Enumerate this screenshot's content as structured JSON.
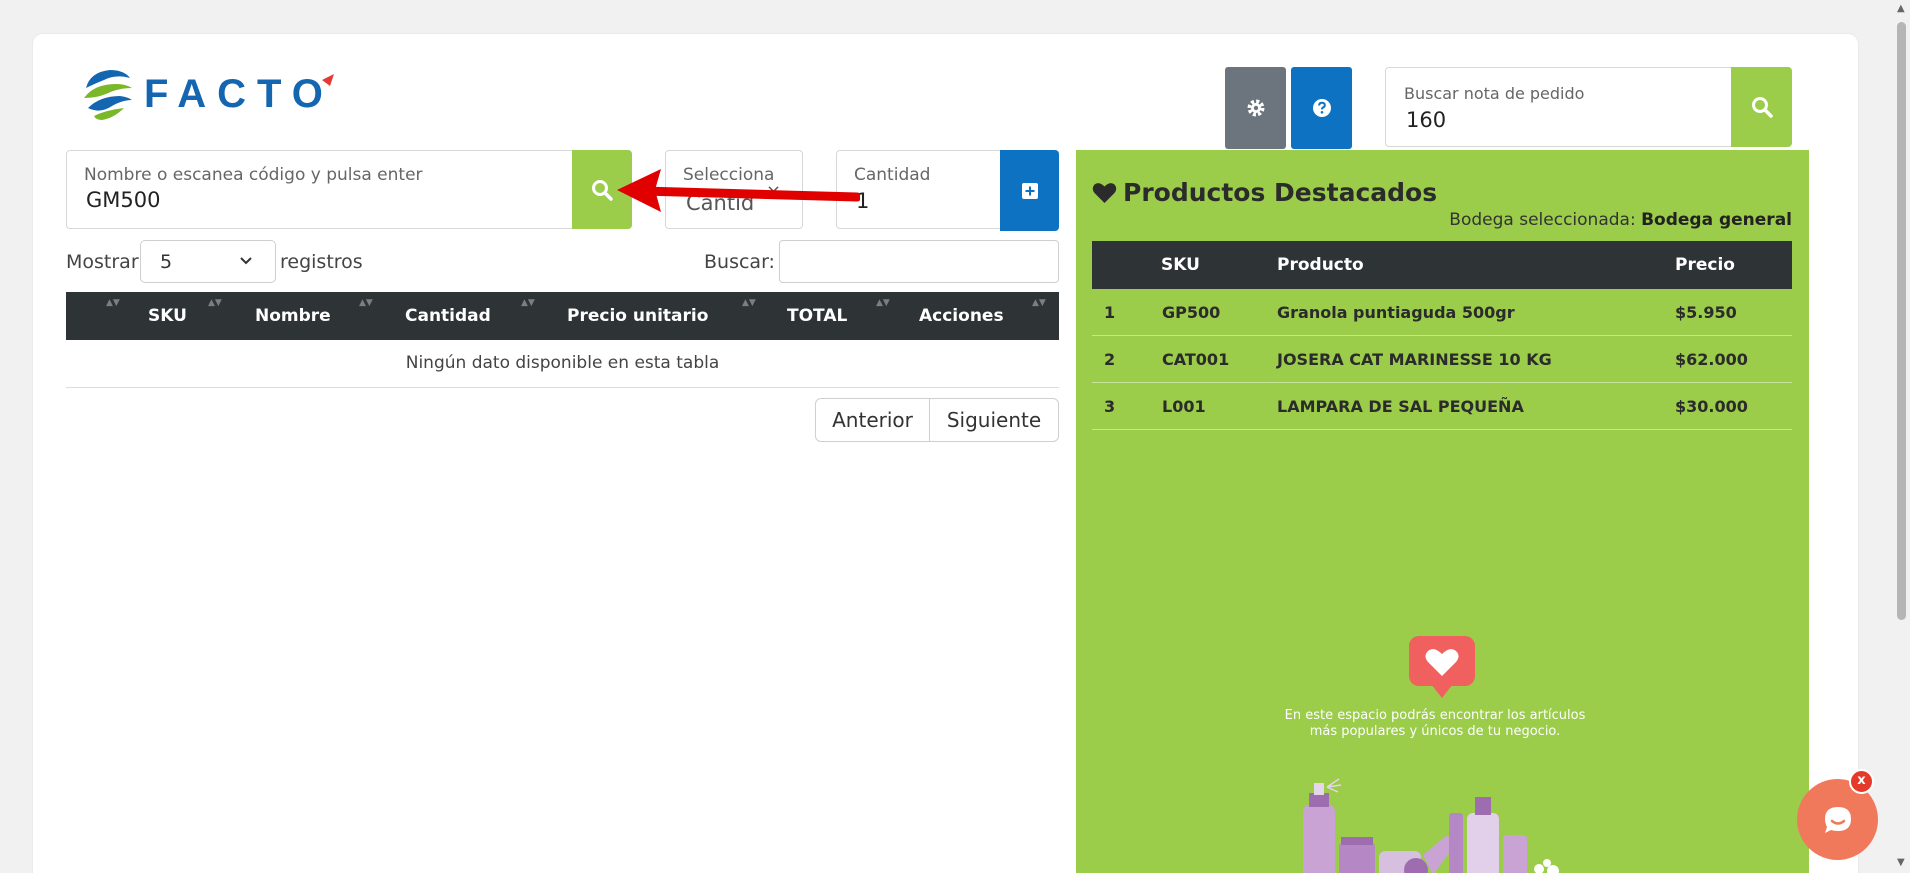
{
  "brand": {
    "name": "FACTO"
  },
  "toolbar": {
    "settings_icon": "gear-icon",
    "help_icon": "question-circle-icon"
  },
  "order_search": {
    "label": "Buscar nota de pedido",
    "value": "160"
  },
  "product_search": {
    "label": "Nombre o escanea código y pulsa enter",
    "value": "GM500"
  },
  "select": {
    "label": "Selecciona",
    "value": "Cantid",
    "clear": "×"
  },
  "quantity": {
    "label": "Cantidad",
    "value": "1"
  },
  "table_controls": {
    "show_label": "Mostrar",
    "show_value": "5",
    "records_label": "registros",
    "search_label": "Buscar:"
  },
  "cart_table": {
    "columns": [
      "SKU",
      "Nombre",
      "Cantidad",
      "Precio unitario",
      "TOTAL",
      "Acciones"
    ],
    "empty_message": "Ningún dato disponible en esta tabla"
  },
  "pagination": {
    "prev": "Anterior",
    "next": "Siguiente"
  },
  "featured": {
    "title": "Productos Destacados",
    "warehouse_label": "Bodega seleccionada:",
    "warehouse_value": "Bodega general",
    "columns": [
      "SKU",
      "Producto",
      "Precio"
    ],
    "rows": [
      {
        "n": "1",
        "sku": "GP500",
        "product": "Granola puntiaguda 500gr",
        "price": "$5.950"
      },
      {
        "n": "2",
        "sku": "CAT001",
        "product": "JOSERA CAT MARINESSE 10 KG",
        "price": "$62.000"
      },
      {
        "n": "3",
        "sku": "L001",
        "product": "LAMPARA DE SAL PEQUEÑA",
        "price": "$30.000"
      }
    ],
    "promo_line1": "En este espacio podrás encontrar los artículos",
    "promo_line2": "más populares y únicos de tu negocio."
  },
  "chat": {
    "close_label": "x"
  },
  "colors": {
    "green": "#9bcc4a",
    "blue": "#0d72c2",
    "dark": "#2e3335",
    "gray": "#6c757d",
    "red_arrow": "#e00000",
    "chat": "#f0795c"
  }
}
